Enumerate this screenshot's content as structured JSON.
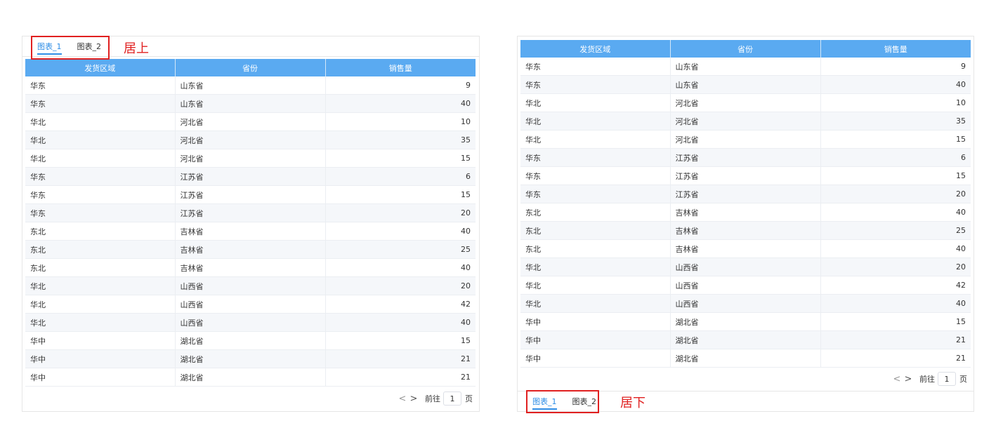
{
  "panels": [
    {
      "tabs": [
        "图表_1",
        "图表_2"
      ],
      "annotation": "居上",
      "columns": [
        "发货区域",
        "省份",
        "销售量"
      ],
      "rows": [
        [
          "华东",
          "山东省",
          "9"
        ],
        [
          "华东",
          "山东省",
          "40"
        ],
        [
          "华北",
          "河北省",
          "10"
        ],
        [
          "华北",
          "河北省",
          "35"
        ],
        [
          "华北",
          "河北省",
          "15"
        ],
        [
          "华东",
          "江苏省",
          "6"
        ],
        [
          "华东",
          "江苏省",
          "15"
        ],
        [
          "华东",
          "江苏省",
          "20"
        ],
        [
          "东北",
          "吉林省",
          "40"
        ],
        [
          "东北",
          "吉林省",
          "25"
        ],
        [
          "东北",
          "吉林省",
          "40"
        ],
        [
          "华北",
          "山西省",
          "20"
        ],
        [
          "华北",
          "山西省",
          "42"
        ],
        [
          "华北",
          "山西省",
          "40"
        ],
        [
          "华中",
          "湖北省",
          "15"
        ],
        [
          "华中",
          "湖北省",
          "21"
        ],
        [
          "华中",
          "湖北省",
          "21"
        ]
      ],
      "pager": {
        "prev": "<",
        "next": ">",
        "goto": "前往",
        "page": "1",
        "unit": "页"
      }
    },
    {
      "tabs": [
        "图表_1",
        "图表_2"
      ],
      "annotation": "居下",
      "columns": [
        "发货区域",
        "省份",
        "销售量"
      ],
      "rows": [
        [
          "华东",
          "山东省",
          "9"
        ],
        [
          "华东",
          "山东省",
          "40"
        ],
        [
          "华北",
          "河北省",
          "10"
        ],
        [
          "华北",
          "河北省",
          "35"
        ],
        [
          "华北",
          "河北省",
          "15"
        ],
        [
          "华东",
          "江苏省",
          "6"
        ],
        [
          "华东",
          "江苏省",
          "15"
        ],
        [
          "华东",
          "江苏省",
          "20"
        ],
        [
          "东北",
          "吉林省",
          "40"
        ],
        [
          "东北",
          "吉林省",
          "25"
        ],
        [
          "东北",
          "吉林省",
          "40"
        ],
        [
          "华北",
          "山西省",
          "20"
        ],
        [
          "华北",
          "山西省",
          "42"
        ],
        [
          "华北",
          "山西省",
          "40"
        ],
        [
          "华中",
          "湖北省",
          "15"
        ],
        [
          "华中",
          "湖北省",
          "21"
        ],
        [
          "华中",
          "湖北省",
          "21"
        ]
      ],
      "pager": {
        "prev": "<",
        "next": ">",
        "goto": "前往",
        "page": "1",
        "unit": "页"
      }
    }
  ],
  "colors": {
    "header": "#5aaaf1",
    "active_tab": "#2f8ee6",
    "annotation": "#e02020"
  }
}
